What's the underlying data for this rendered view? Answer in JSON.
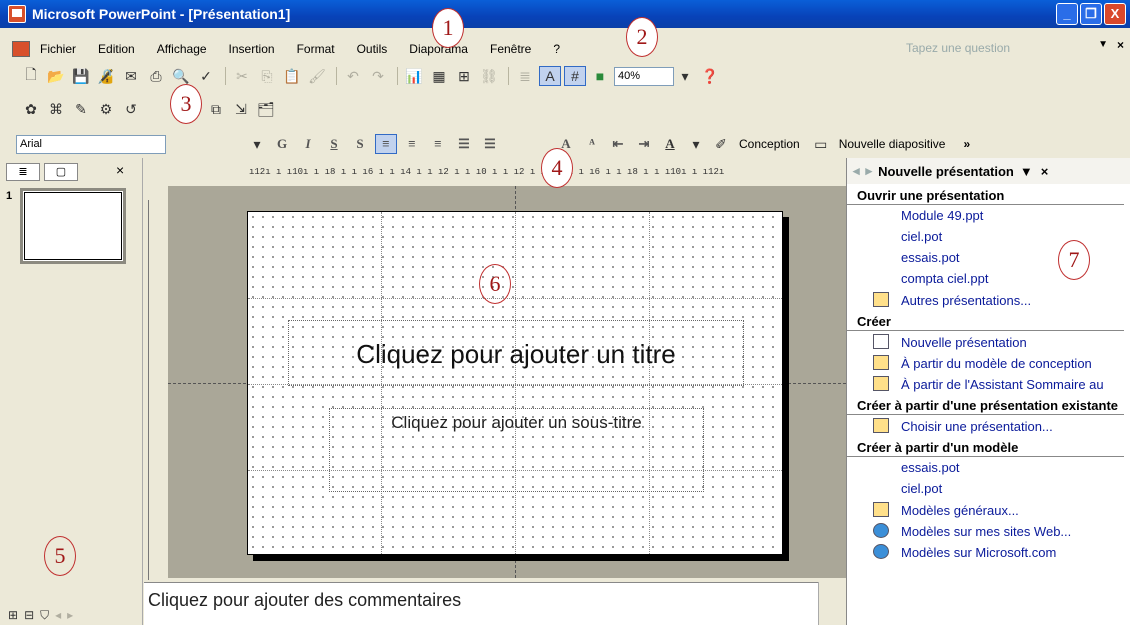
{
  "window": {
    "title": "Microsoft PowerPoint - [Présentation1]",
    "minimize": "_",
    "restore": "❐",
    "close": "X"
  },
  "menu": {
    "items": [
      "Fichier",
      "Edition",
      "Affichage",
      "Insertion",
      "Format",
      "Outils",
      "Diaporama",
      "Fenêtre",
      "?"
    ],
    "help_placeholder": "Tapez une question",
    "close": "×"
  },
  "toolbar": {
    "zoom": "40%"
  },
  "formatting": {
    "font": "Arial",
    "bold": "G",
    "italic": "I",
    "underline": "S",
    "shadow": "S",
    "conception": "Conception",
    "new_slide": "Nouvelle diapositive",
    "more": "»"
  },
  "left_panel": {
    "close": "×",
    "slide_number": "1"
  },
  "ruler": {
    "horizontal": "ı12ı ı ı10ı ı ı8 ı ı ı6 ı ı ı4 ı ı ı2 ı ı ı0 ı ı ı2 ı ı ı4 ı ı ı6 ı ı ı8 ı ı ı10ı ı ı12ı"
  },
  "slide": {
    "title_placeholder": "Cliquez pour ajouter un titre",
    "subtitle_placeholder": "Cliquez pour ajouter un sous-titre"
  },
  "notes": {
    "placeholder": "Cliquez pour ajouter des commentaires"
  },
  "task_pane": {
    "title": "Nouvelle présentation",
    "close": "×",
    "sections": {
      "open": "Ouvrir une présentation",
      "create": "Créer",
      "from_existing": "Créer à partir d'une présentation existante",
      "from_template": "Créer à partir d'un modèle"
    },
    "open_items": [
      "Module 49.ppt",
      "ciel.pot",
      "essais.pot",
      "compta ciel.ppt"
    ],
    "more_presentations": "Autres présentations...",
    "create_items": [
      "Nouvelle présentation",
      "À partir du modèle de conception",
      "À partir de l'Assistant Sommaire au"
    ],
    "choose_presentation": "Choisir une présentation...",
    "template_items": [
      "essais.pot",
      "ciel.pot"
    ],
    "template_links": [
      "Modèles généraux...",
      "Modèles sur mes sites Web...",
      "Modèles sur Microsoft.com"
    ]
  },
  "annotations": [
    "1",
    "2",
    "3",
    "4",
    "5",
    "6",
    "7"
  ]
}
